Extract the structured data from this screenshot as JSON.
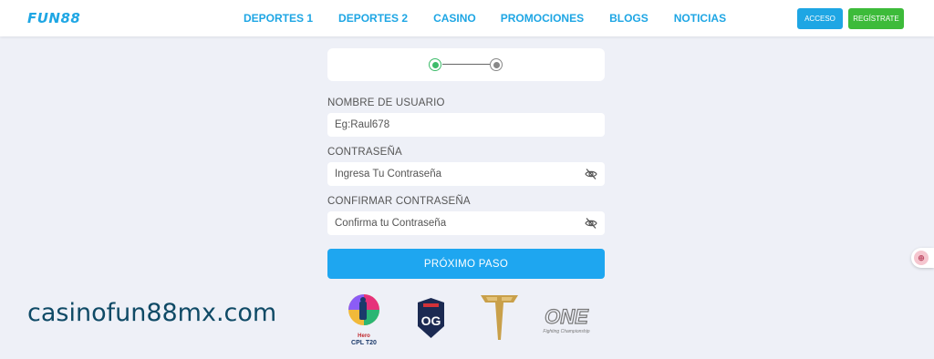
{
  "header": {
    "logo": "FUN88",
    "nav": [
      "DEPORTES 1",
      "DEPORTES 2",
      "CASINO",
      "PROMOCIONES",
      "BLOGS",
      "NOTICIAS"
    ],
    "acceso_label": "ACCESO",
    "registrate_label": "REGÍSTRATE"
  },
  "form": {
    "username": {
      "label": "NOMBRE DE USUARIO",
      "placeholder": "Eg:Raul678"
    },
    "password": {
      "label": "CONTRASEÑA",
      "placeholder": "Ingresa Tu Contraseña"
    },
    "confirm_password": {
      "label": "CONFIRMAR CONTRASEÑA",
      "placeholder": "Confirma tu Contraseña"
    },
    "next_label": "PRÓXIMO PASO"
  },
  "stepper": {
    "current_step": 1,
    "total_steps": 2
  },
  "sponsors": {
    "hero_brand": "Hero",
    "hero_event": "CPL T20",
    "og": "OG",
    "one_main": "ONE",
    "one_sub": "Fighting Championship"
  },
  "watermark": "casinofun88mx.com",
  "colors": {
    "brand_blue": "#1ea6e4",
    "register_green": "#3dbb3a",
    "step_active": "#3dbb6a"
  }
}
